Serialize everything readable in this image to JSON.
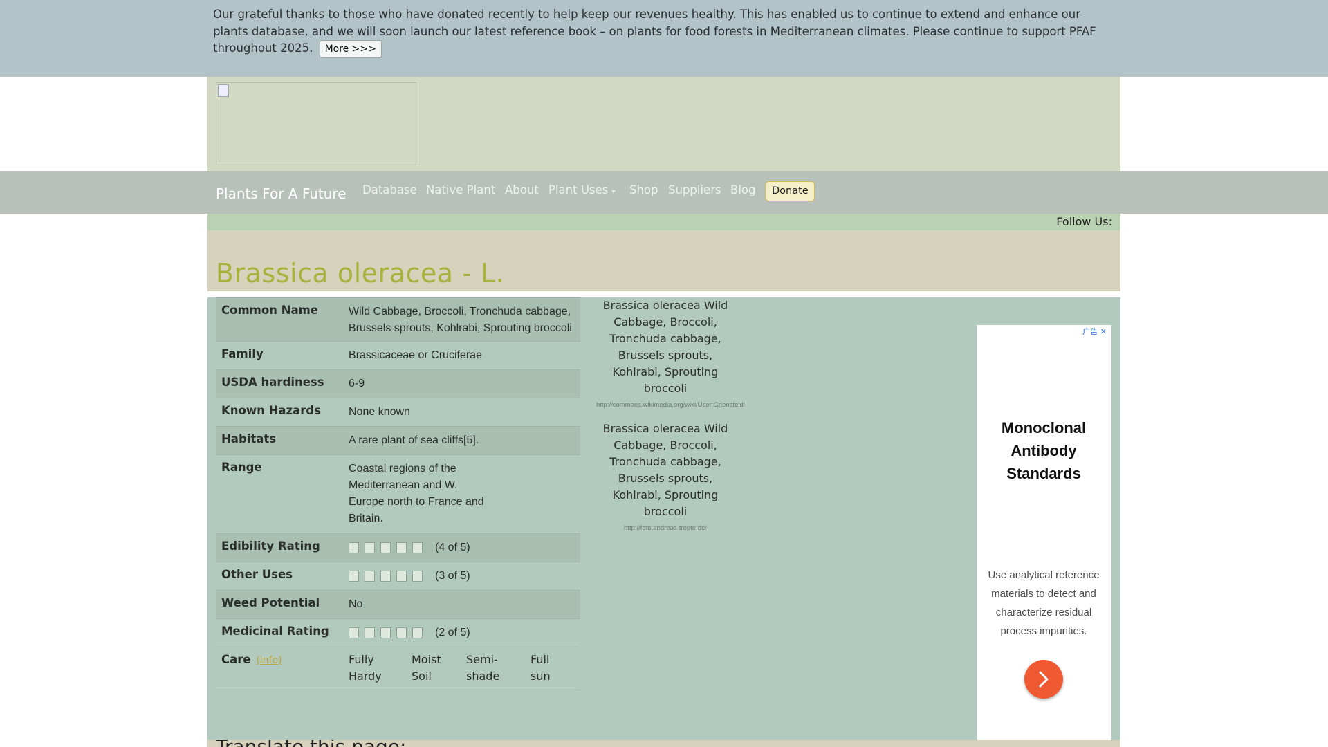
{
  "banner": {
    "text": "Our grateful thanks to those who have donated recently to help keep our revenues healthy. This has enabled us to continue to extend and enhance our plants database, and we will soon launch our latest reference book – on plants for food forests in Mediterranean climates. Please continue to support PFAF throughout 2025.",
    "more_label": "More >>>"
  },
  "nav": {
    "brand": "Plants For A Future",
    "links": [
      "Database",
      "Native Plant",
      "About",
      "Plant Uses",
      "Shop",
      "Suppliers",
      "Blog"
    ],
    "donate_label": "Donate"
  },
  "follow": {
    "label": "Follow Us:"
  },
  "plant": {
    "title": "Brassica oleracea - L.",
    "facts": [
      {
        "label": "Common Name",
        "value": "Wild Cabbage, Broccoli, Tronchuda cabbage, Brussels sprouts, Kohlrabi, Sprouting broccoli"
      },
      {
        "label": "Family",
        "value": "Brassicaceae or Cruciferae"
      },
      {
        "label": "USDA hardiness",
        "value": "6-9"
      },
      {
        "label": "Known Hazards",
        "value": "None known"
      },
      {
        "label": "Habitats",
        "value": "A rare plant of sea cliffs[5]."
      },
      {
        "label": "Range",
        "value": "Coastal regions of the Mediterranean and W. Europe north to France and Britain."
      },
      {
        "label": "Edibility Rating",
        "value": "(4 of 5)",
        "score": 4
      },
      {
        "label": "Other Uses",
        "value": "(3 of 5)",
        "score": 3
      },
      {
        "label": "Weed Potential",
        "value": "No"
      },
      {
        "label": "Medicinal Rating",
        "value": "(2 of 5)",
        "score": 2
      },
      {
        "label": "Care",
        "info": "(info)",
        "icons": [
          "Fully Hardy",
          "Moist Soil",
          "Semi-shade",
          "Full sun"
        ]
      }
    ],
    "photos": [
      {
        "alt": "Brassica oleracea Wild Cabbage, Broccoli, Tronchuda cabbage, Brussels sprouts, Kohlrabi, Sprouting broccoli",
        "credit": "http://commons.wikimedia.org/wiki/User:Griensteidl"
      },
      {
        "alt": "Brassica oleracea Wild Cabbage, Broccoli, Tronchuda cabbage, Brussels sprouts, Kohlrabi, Sprouting broccoli",
        "credit": "http://foto.andreas-trepte.de/"
      }
    ]
  },
  "ad": {
    "choice_label": "广告",
    "title": "Monoclonal Antibody Standards",
    "body": "Use analytical reference materials to detect and characterize residual process impurities."
  },
  "translate": {
    "label": "Translate this page:"
  },
  "colors": {
    "banner": "#b2c4c7",
    "logo_band": "#d2d8c1",
    "navbar": "#b8c1b9",
    "title_band": "#d6d2bb",
    "title_text": "#a4b43c",
    "main": "#b2c9bd",
    "ad_arrow": "#f05a32"
  }
}
